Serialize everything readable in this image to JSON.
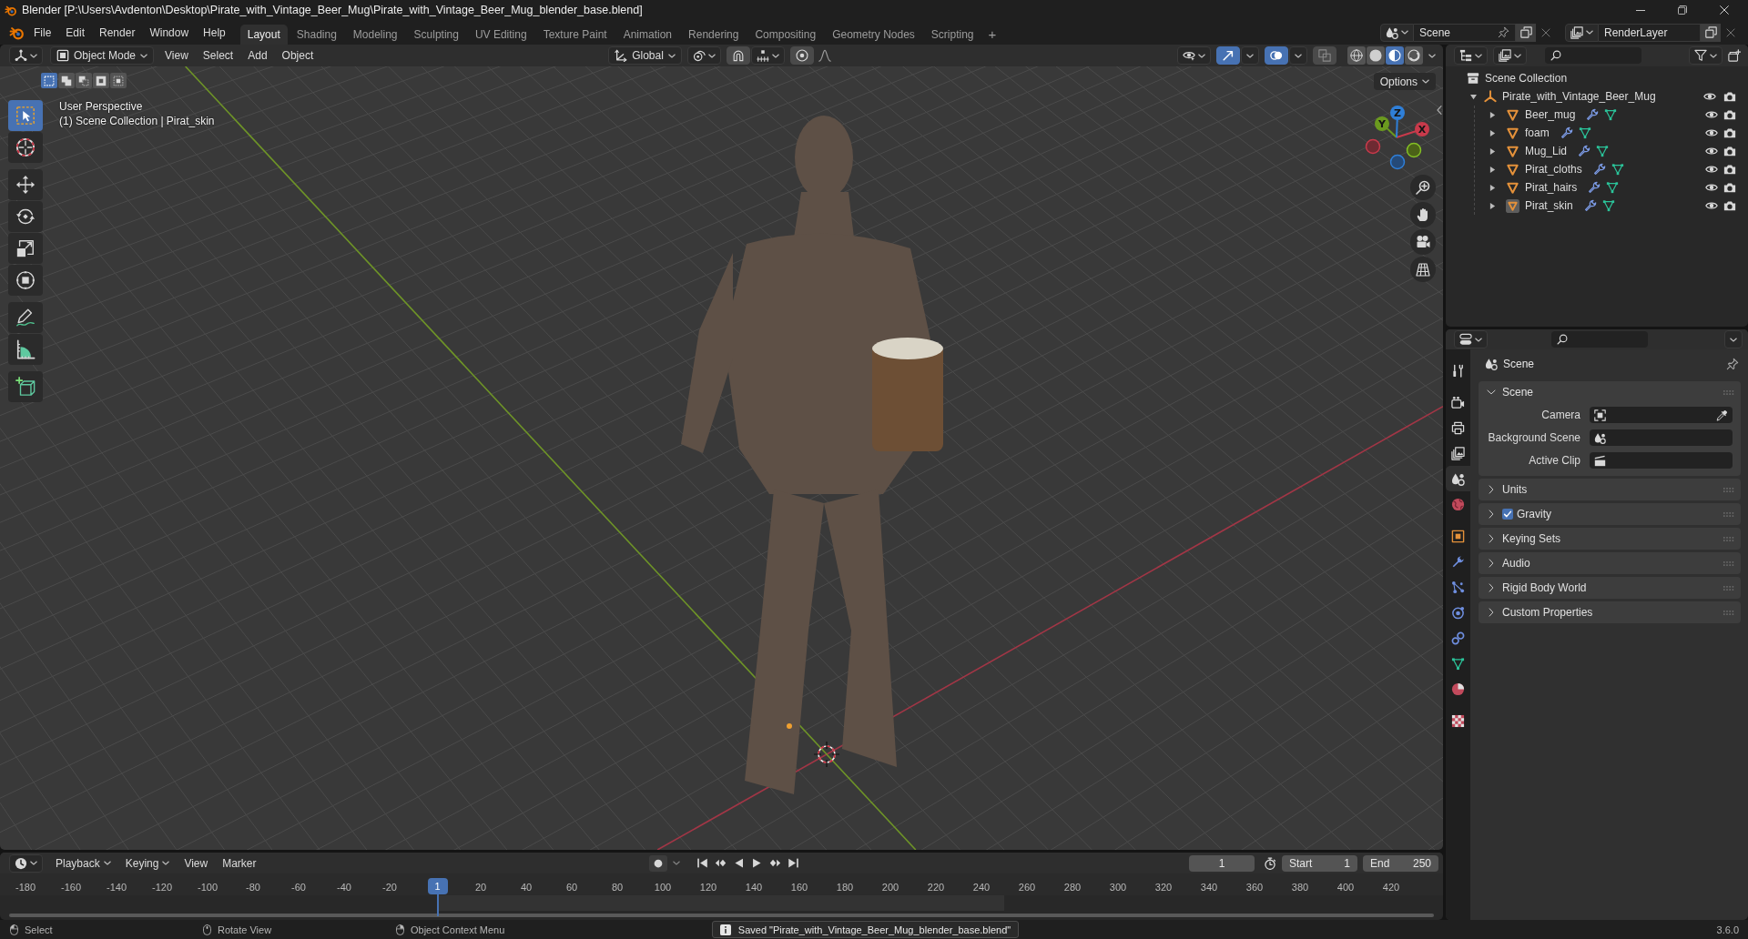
{
  "window": {
    "title": "Blender [P:\\Users\\Avdenton\\Desktop\\Pirate_with_Vintage_Beer_Mug\\Pirate_with_Vintage_Beer_Mug_blender_base.blend]"
  },
  "menu": [
    "File",
    "Edit",
    "Render",
    "Window",
    "Help"
  ],
  "workspaces": [
    {
      "label": "Layout",
      "selected": true
    },
    {
      "label": "Shading",
      "selected": false
    },
    {
      "label": "Modeling",
      "selected": false
    },
    {
      "label": "Sculpting",
      "selected": false
    },
    {
      "label": "UV Editing",
      "selected": false
    },
    {
      "label": "Texture Paint",
      "selected": false
    },
    {
      "label": "Animation",
      "selected": false
    },
    {
      "label": "Rendering",
      "selected": false
    },
    {
      "label": "Compositing",
      "selected": false
    },
    {
      "label": "Geometry Nodes",
      "selected": false
    },
    {
      "label": "Scripting",
      "selected": false
    }
  ],
  "add_workspace": "+",
  "scene_selector": {
    "value": "Scene"
  },
  "view_layer_selector": {
    "value": "RenderLayer"
  },
  "viewport": {
    "mode": "Object Mode",
    "menus": [
      "View",
      "Select",
      "Add",
      "Object"
    ],
    "orientation": "Global",
    "snap": {
      "on": false
    },
    "proportional_editing": {
      "on": false
    },
    "toggles": [
      {
        "kind": "gizmos",
        "on": true
      },
      {
        "kind": "overlays",
        "on": true
      },
      {
        "kind": "xray",
        "on": false
      }
    ],
    "shading": [
      {
        "kind": "wireframe",
        "selected": false
      },
      {
        "kind": "solid",
        "selected": false
      },
      {
        "kind": "material",
        "selected": true
      },
      {
        "kind": "rendered",
        "selected": false
      }
    ],
    "options": "Options",
    "select_modes": [
      {
        "kind": "set",
        "selected": true
      },
      {
        "kind": "extend",
        "selected": false
      },
      {
        "kind": "subtract",
        "selected": false
      },
      {
        "kind": "invert",
        "selected": false
      },
      {
        "kind": "intersect",
        "selected": false
      }
    ],
    "tool_groups": [
      {
        "tools": [
          {
            "kind": "select-box",
            "selected": true
          },
          {
            "kind": "cursor",
            "selected": false
          }
        ]
      },
      {
        "tools": [
          {
            "kind": "move",
            "selected": false
          },
          {
            "kind": "rotate",
            "selected": false
          },
          {
            "kind": "scale",
            "selected": false
          },
          {
            "kind": "transform",
            "selected": false
          }
        ]
      },
      {
        "tools": [
          {
            "kind": "annotate",
            "selected": false
          },
          {
            "kind": "measure",
            "selected": false
          }
        ]
      },
      {
        "tools": [
          {
            "kind": "add-cube",
            "selected": false
          }
        ]
      }
    ],
    "info": [
      "User Perspective",
      "(1) Scene Collection | Pirat_skin"
    ],
    "gizmo": {
      "x": "X",
      "y": "Y",
      "z": "Z"
    },
    "navigation": [
      {
        "kind": "zoom"
      },
      {
        "kind": "pan"
      },
      {
        "kind": "camera"
      },
      {
        "kind": "perspective"
      }
    ]
  },
  "outliner": {
    "root": "Scene Collection",
    "collections": [
      {
        "name": "Pirate_with_Vintage_Beer_Mug",
        "expanded": true,
        "visible": true,
        "renderable": true,
        "children": [
          {
            "name": "Beer_mug",
            "expanded": false,
            "active": false,
            "visible": true,
            "renderable": true
          },
          {
            "name": "foam",
            "expanded": false,
            "active": false,
            "visible": true,
            "renderable": true
          },
          {
            "name": "Mug_Lid",
            "expanded": false,
            "active": false,
            "visible": true,
            "renderable": true
          },
          {
            "name": "Pirat_cloths",
            "expanded": false,
            "active": false,
            "visible": true,
            "renderable": true
          },
          {
            "name": "Pirat_hairs",
            "expanded": false,
            "active": false,
            "visible": true,
            "renderable": true
          },
          {
            "name": "Pirat_skin",
            "expanded": false,
            "active": true,
            "visible": true,
            "renderable": true
          }
        ]
      }
    ]
  },
  "properties": {
    "tab_groups": [
      {
        "tabs": [
          {
            "kind": "tool",
            "selected": false
          }
        ]
      },
      {
        "tabs": [
          {
            "kind": "render",
            "selected": false
          },
          {
            "kind": "output",
            "selected": false
          },
          {
            "kind": "view-layer",
            "selected": false
          },
          {
            "kind": "scene",
            "selected": true
          },
          {
            "kind": "world",
            "selected": false
          }
        ]
      },
      {
        "tabs": [
          {
            "kind": "object",
            "selected": false
          },
          {
            "kind": "modifiers",
            "selected": false
          },
          {
            "kind": "particles",
            "selected": false
          },
          {
            "kind": "physics",
            "selected": false
          },
          {
            "kind": "constraints",
            "selected": false
          },
          {
            "kind": "data",
            "selected": false
          },
          {
            "kind": "material",
            "selected": false
          }
        ]
      },
      {
        "tabs": [
          {
            "kind": "texture",
            "selected": false
          }
        ]
      }
    ],
    "context": "Scene",
    "panels": [
      {
        "title": "Scene",
        "expanded": true,
        "fields": [
          {
            "label": "Camera",
            "kind": "camera"
          },
          {
            "label": "Background Scene",
            "kind": "scene"
          },
          {
            "label": "Active Clip",
            "kind": "clip"
          }
        ]
      },
      {
        "title": "Units",
        "expanded": false
      },
      {
        "title": "Gravity",
        "expanded": false,
        "toggle": {
          "checked": true
        }
      },
      {
        "title": "Keying Sets",
        "expanded": false
      },
      {
        "title": "Audio",
        "expanded": false
      },
      {
        "title": "Rigid Body World",
        "expanded": false
      },
      {
        "title": "Custom Properties",
        "expanded": false
      }
    ]
  },
  "timeline": {
    "menus": [
      {
        "label": "Playback",
        "dropdown": true
      },
      {
        "label": "Keying",
        "dropdown": true
      },
      {
        "label": "View",
        "dropdown": false
      },
      {
        "label": "Marker",
        "dropdown": false
      }
    ],
    "auto_keying": {
      "on": false
    },
    "current_frame": "1",
    "start_label": "Start",
    "start": "1",
    "end_label": "End",
    "end": "250",
    "ruler": [
      "-180",
      "-160",
      "-140",
      "-120",
      "-100",
      "-80",
      "-60",
      "-40",
      "-20",
      "20",
      "40",
      "60",
      "80",
      "100",
      "120",
      "140",
      "160",
      "180",
      "200",
      "220",
      "240",
      "260",
      "280",
      "300",
      "320",
      "340",
      "360",
      "380",
      "400",
      "420"
    ],
    "playhead": "1"
  },
  "status_bar": {
    "hints": [
      {
        "kind": "left-click",
        "label": "Select"
      },
      {
        "kind": "middle-click",
        "label": "Rotate View"
      },
      {
        "kind": "right-click",
        "label": "Object Context Menu"
      }
    ],
    "message": "Saved \"Pirate_with_Vintage_Beer_Mug_blender_base.blend\"",
    "version": "3.6.0"
  }
}
